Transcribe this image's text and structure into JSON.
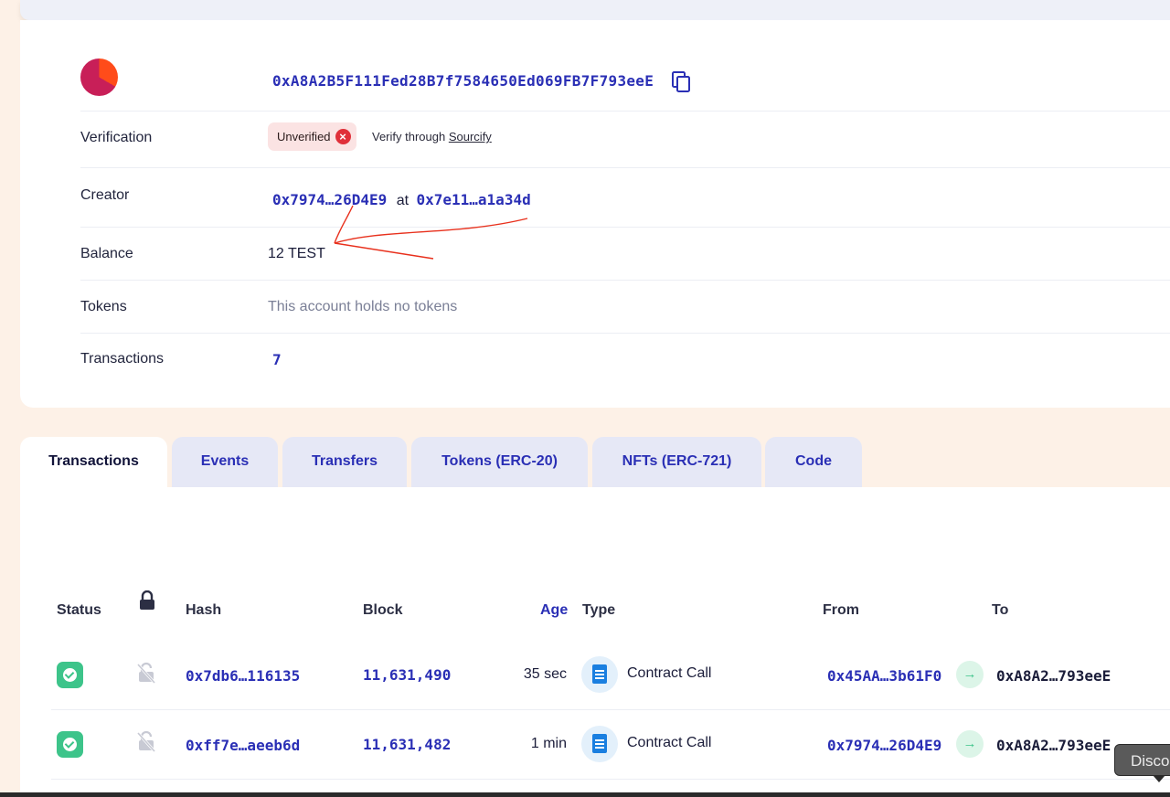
{
  "account": {
    "address": "0xA8A2B5F111Fed28B7f7584650Ed069FB7F793eeE",
    "copy_icon": "copy-icon"
  },
  "details": {
    "verification": {
      "label": "Verification",
      "badge": "Unverified",
      "verify_prefix": "Verify through",
      "verify_link": "Sourcify"
    },
    "creator": {
      "label": "Creator",
      "address": "0x7974…26D4E9",
      "at": "at",
      "tx": "0x7e11…a1a34d"
    },
    "balance": {
      "label": "Balance",
      "value": "12 TEST"
    },
    "tokens": {
      "label": "Tokens",
      "value": "This account holds no tokens"
    },
    "transactions": {
      "label": "Transactions",
      "value": "7"
    }
  },
  "tabs": [
    {
      "label": "Transactions",
      "active": true
    },
    {
      "label": "Events",
      "active": false
    },
    {
      "label": "Transfers",
      "active": false
    },
    {
      "label": "Tokens (ERC-20)",
      "active": false
    },
    {
      "label": "NFTs (ERC-721)",
      "active": false
    },
    {
      "label": "Code",
      "active": false
    }
  ],
  "table": {
    "headers": {
      "status": "Status",
      "hash": "Hash",
      "block": "Block",
      "age": "Age",
      "type": "Type",
      "from": "From",
      "to": "To"
    },
    "rows": [
      {
        "status": "success",
        "hash": "0x7db6…116135",
        "block": "11,631,490",
        "age": "35 sec",
        "type": "Contract Call",
        "from": "0x45AA…3b61F0",
        "to": "0xA8A2…793eeE"
      },
      {
        "status": "success",
        "hash": "0xff7e…aeeb6d",
        "block": "11,631,482",
        "age": "1 min",
        "type": "Contract Call",
        "from": "0x7974…26D4E9",
        "to": "0xA8A2…793eeE"
      }
    ]
  },
  "tooltip": {
    "text": "Disco"
  },
  "colors": {
    "accent": "#2a2fb5",
    "success": "#3dc48a",
    "error": "#e0303a",
    "background": "#fdf1e7"
  }
}
